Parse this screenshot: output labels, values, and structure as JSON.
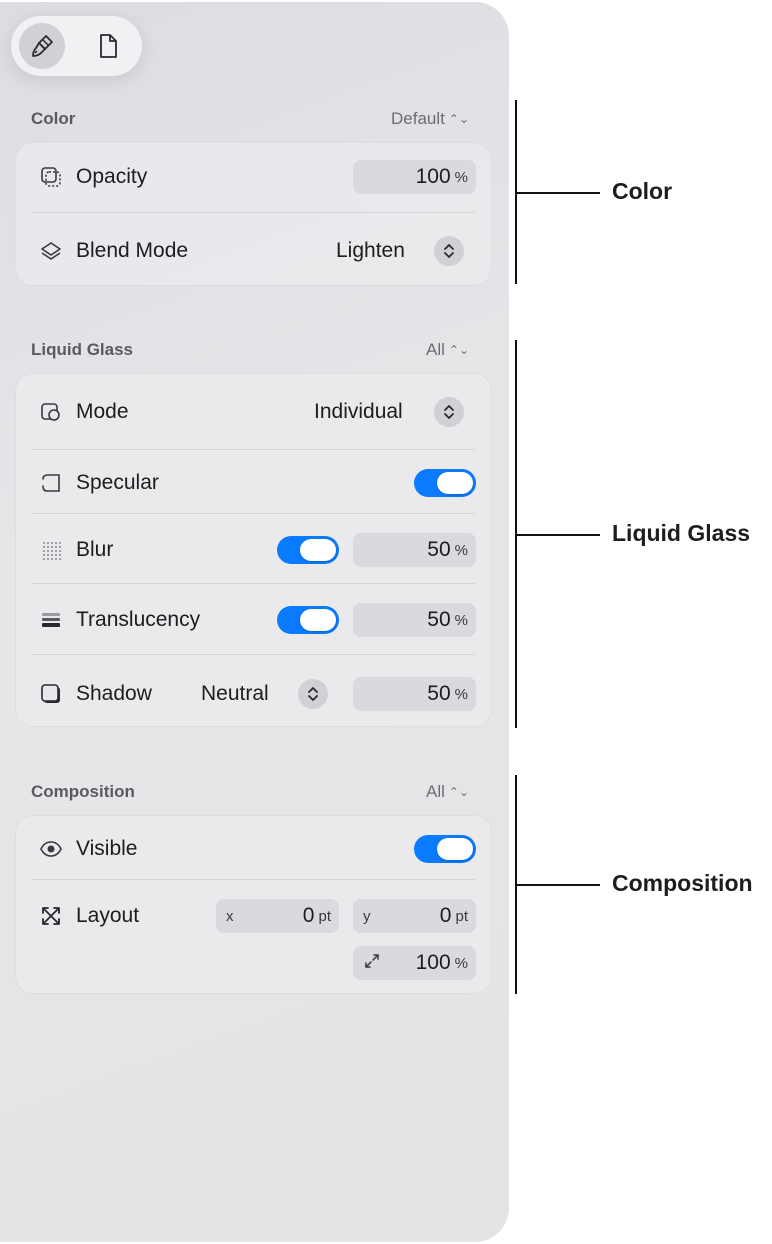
{
  "tabs": [
    {
      "icon": "paintbrush-icon"
    },
    {
      "icon": "document-icon"
    }
  ],
  "color": {
    "title": "Color",
    "menu": "Default",
    "opacity": {
      "label": "Opacity",
      "value": "100",
      "unit": "%"
    },
    "blend": {
      "label": "Blend Mode",
      "value": "Lighten"
    }
  },
  "glass": {
    "title": "Liquid Glass",
    "menu": "All",
    "mode": {
      "label": "Mode",
      "value": "Individual"
    },
    "specular": {
      "label": "Specular",
      "on": true
    },
    "blur": {
      "label": "Blur",
      "on": true,
      "value": "50",
      "unit": "%"
    },
    "translucency": {
      "label": "Translucency",
      "on": true,
      "value": "50",
      "unit": "%"
    },
    "shadow": {
      "label": "Shadow",
      "mode": "Neutral",
      "value": "50",
      "unit": "%"
    }
  },
  "composition": {
    "title": "Composition",
    "menu": "All",
    "visible": {
      "label": "Visible",
      "on": true
    },
    "layout": {
      "label": "Layout",
      "x_prefix": "x",
      "x_value": "0",
      "x_unit": "pt",
      "y_prefix": "y",
      "y_value": "0",
      "y_unit": "pt",
      "scale_value": "100",
      "scale_unit": "%"
    }
  },
  "callouts": {
    "color": "Color",
    "glass": "Liquid Glass",
    "composition": "Composition"
  },
  "colors": {
    "accent": "#0a7aff"
  }
}
